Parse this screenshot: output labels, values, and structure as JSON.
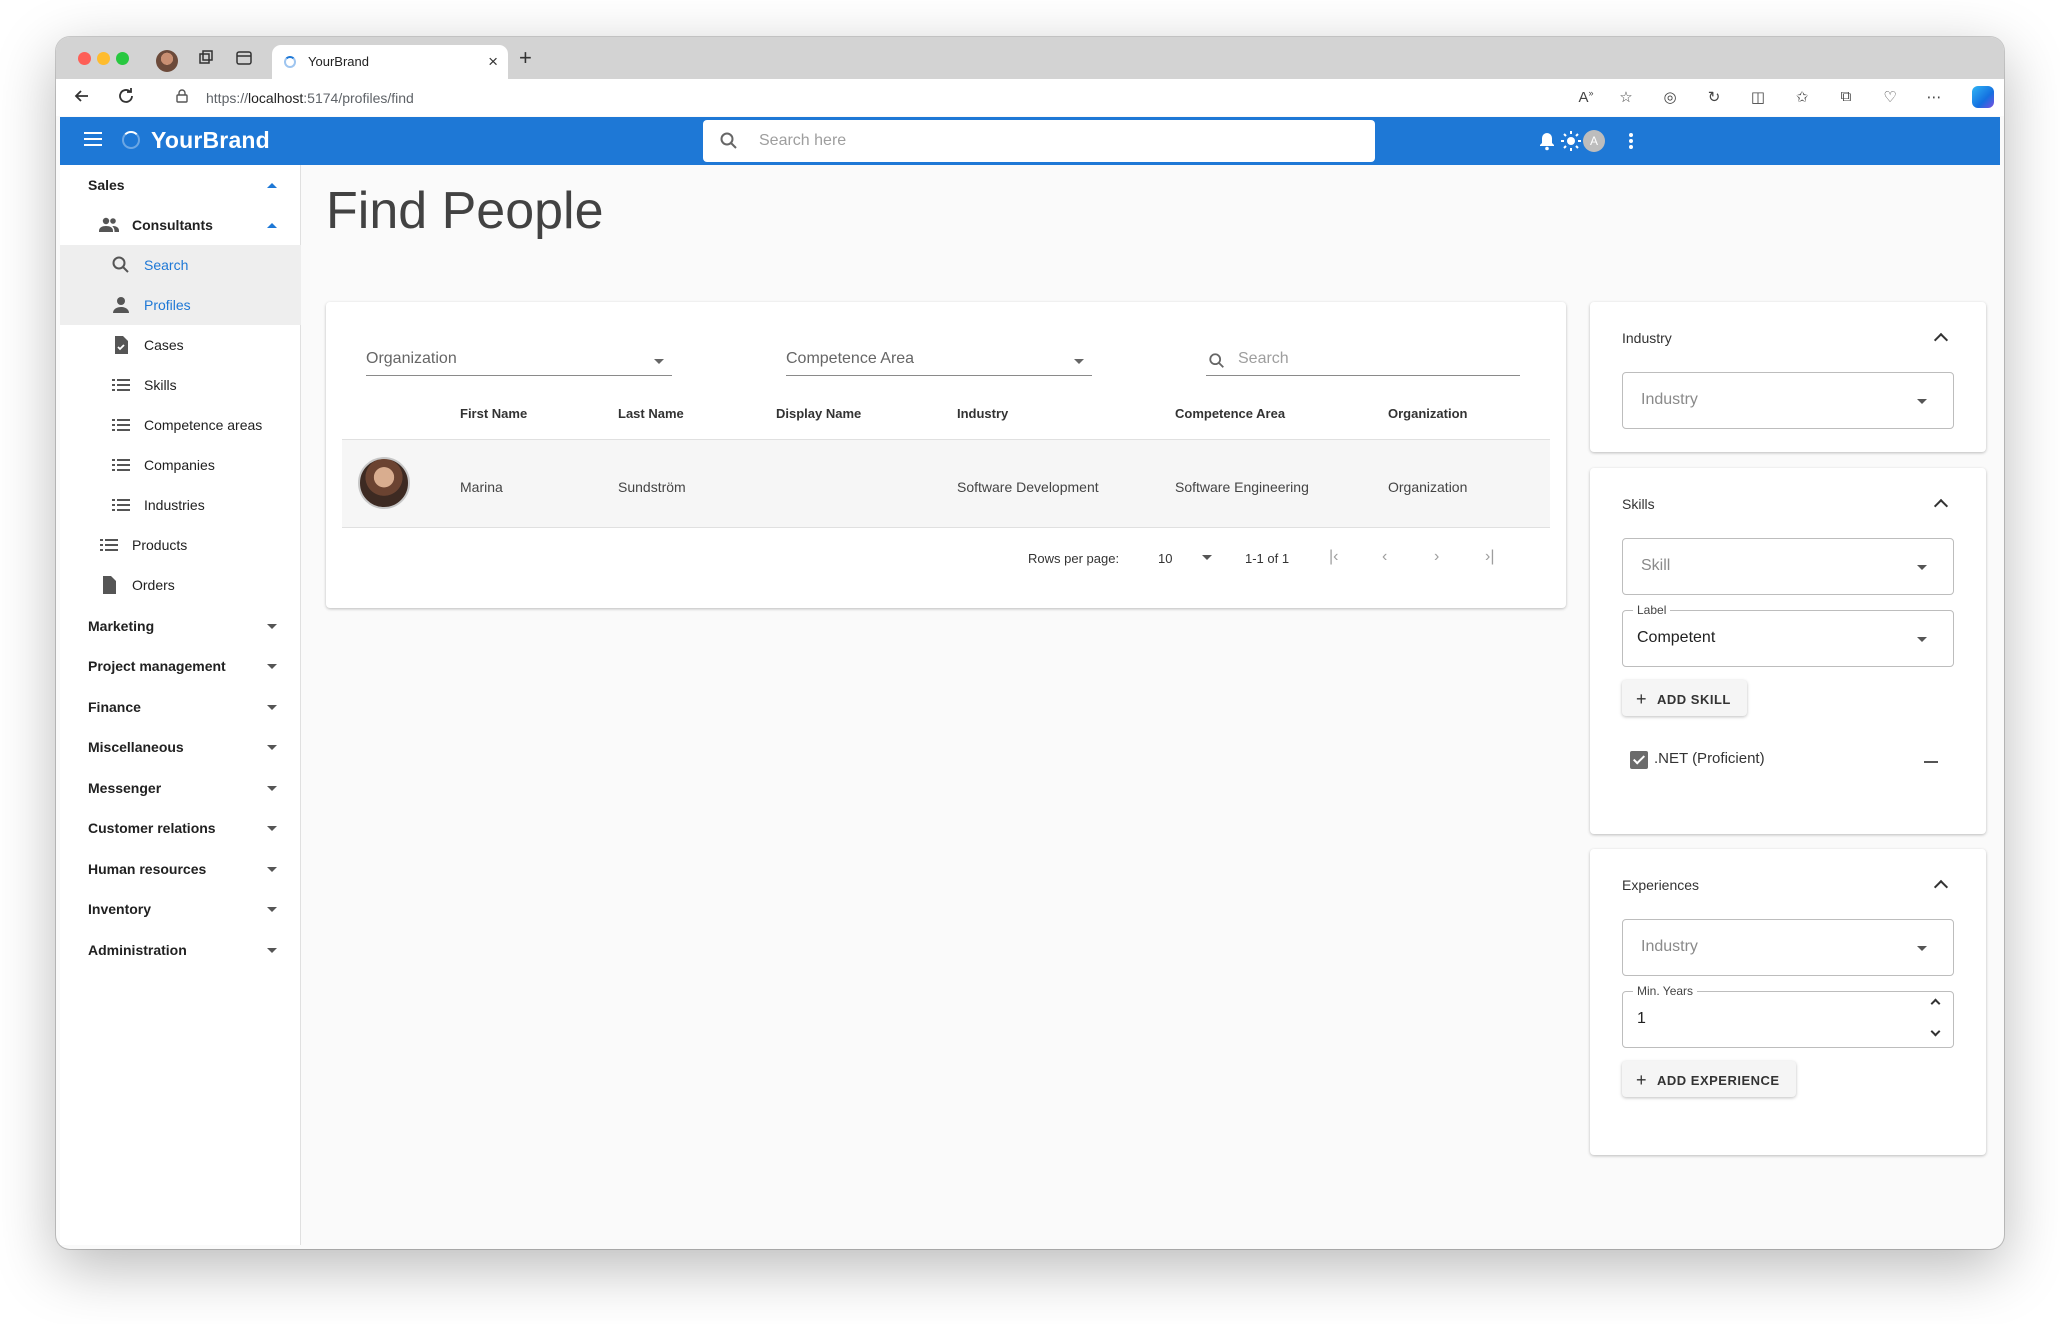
{
  "browser": {
    "tab_title": "YourBrand",
    "url_prefix": "https://",
    "url_host": "localhost",
    "url_rest": ":5174/profiles/find"
  },
  "appbar": {
    "brand": "YourBrand",
    "search_placeholder": "Search here",
    "avatar_letter": "A"
  },
  "sidebar": {
    "sales": "Sales",
    "consultants": "Consultants",
    "search": "Search",
    "profiles": "Profiles",
    "cases": "Cases",
    "skills": "Skills",
    "competence_areas": "Competence areas",
    "companies": "Companies",
    "industries": "Industries",
    "products": "Products",
    "orders": "Orders",
    "groups": [
      "Marketing",
      "Project management",
      "Finance",
      "Miscellaneous",
      "Messenger",
      "Customer relations",
      "Human resources",
      "Inventory",
      "Administration"
    ]
  },
  "main": {
    "title": "Find People",
    "filters": {
      "organization": "Organization",
      "competence_area": "Competence Area",
      "search_placeholder": "Search"
    },
    "columns": [
      "First Name",
      "Last Name",
      "Display Name",
      "Industry",
      "Competence Area",
      "Organization"
    ],
    "rows": [
      {
        "first_name": "Marina",
        "last_name": "Sundström",
        "display_name": "",
        "industry": "Software Development",
        "competence_area": "Software Engineering",
        "organization": "Organization"
      }
    ],
    "pagination": {
      "rows_per_page_label": "Rows per page:",
      "rows_per_page": "10",
      "range": "1-1 of 1"
    }
  },
  "panels": {
    "industry": {
      "title": "Industry",
      "select_placeholder": "Industry"
    },
    "skills": {
      "title": "Skills",
      "skill_placeholder": "Skill",
      "label_legend": "Label",
      "label_value": "Competent",
      "add_button": "ADD SKILL",
      "selected": [
        ".NET (Proficient)"
      ]
    },
    "experiences": {
      "title": "Experiences",
      "industry_placeholder": "Industry",
      "min_years_legend": "Min. Years",
      "min_years_value": "1",
      "add_button": "ADD EXPERIENCE"
    }
  },
  "colors": {
    "primary": "#1e78d6",
    "appbar_text": "#ffffff"
  }
}
